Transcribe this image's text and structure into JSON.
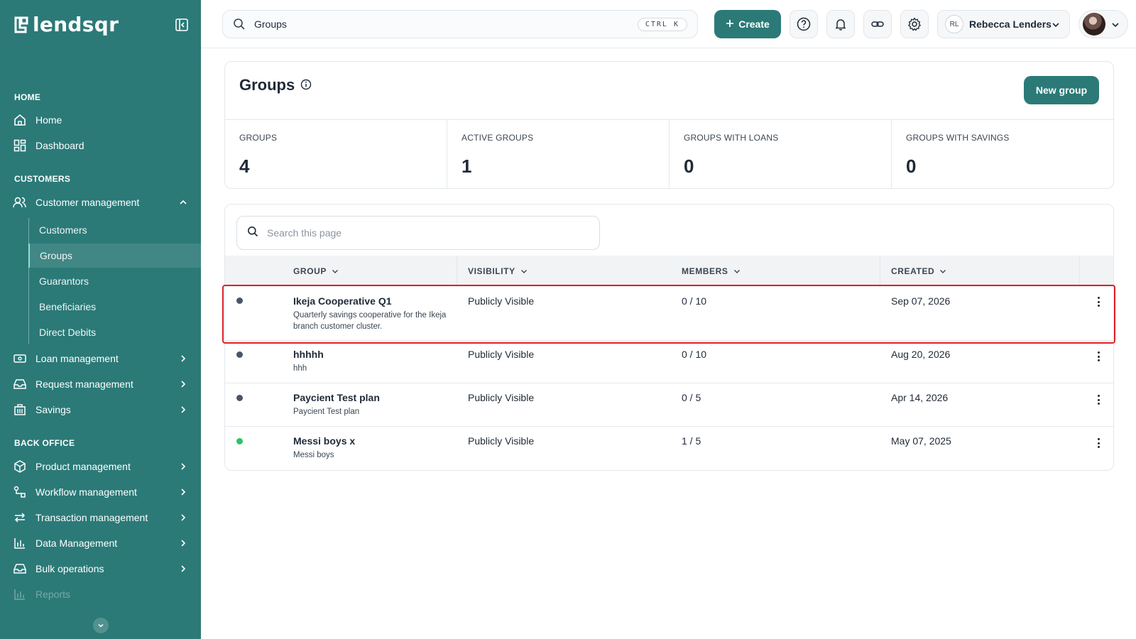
{
  "app": {
    "brand": "lendsqr"
  },
  "sidebar": {
    "sections": {
      "home": "HOME",
      "customers": "CUSTOMERS",
      "back_office": "BACK OFFICE"
    },
    "home_items": [
      {
        "label": "Home",
        "icon": "house-icon"
      },
      {
        "label": "Dashboard",
        "icon": "dashboard-grid-icon"
      }
    ],
    "customer_management": {
      "label": "Customer management",
      "icon": "users-icon"
    },
    "customer_sub_items": [
      {
        "label": "Customers"
      },
      {
        "label": "Groups",
        "active": true
      },
      {
        "label": "Guarantors"
      },
      {
        "label": "Beneficiaries"
      },
      {
        "label": "Direct Debits"
      }
    ],
    "customer_items": [
      {
        "label": "Loan management",
        "icon": "money-icon"
      },
      {
        "label": "Request management",
        "icon": "inbox-icon"
      },
      {
        "label": "Savings",
        "icon": "bank-icon"
      }
    ],
    "back_office_items": [
      {
        "label": "Product management",
        "icon": "box-icon"
      },
      {
        "label": "Workflow management",
        "icon": "workflow-icon"
      },
      {
        "label": "Transaction management",
        "icon": "transfer-arrows-icon"
      },
      {
        "label": "Data Management",
        "icon": "chart-bars-icon"
      },
      {
        "label": "Bulk operations",
        "icon": "inbox-icon"
      },
      {
        "label": "Reports",
        "icon": "chart-bars-icon"
      }
    ]
  },
  "topbar": {
    "search_value": "Groups",
    "shortcut": "CTRL K",
    "create_label": "Create",
    "user_initials": "RL",
    "user_name": "Rebecca Lenders"
  },
  "page": {
    "title": "Groups",
    "new_group_label": "New group",
    "stats": [
      {
        "label": "GROUPS",
        "value": "4"
      },
      {
        "label": "ACTIVE GROUPS",
        "value": "1"
      },
      {
        "label": "GROUPS WITH LOANS",
        "value": "0"
      },
      {
        "label": "GROUPS WITH SAVINGS",
        "value": "0"
      }
    ]
  },
  "table": {
    "search_placeholder": "Search this page",
    "columns": [
      "GROUP",
      "VISIBILITY",
      "MEMBERS",
      "CREATED"
    ],
    "rows": [
      {
        "name": "Ikeja Cooperative Q1",
        "description": "Quarterly savings cooperative for the Ikeja branch customer cluster.",
        "visibility": "Publicly Visible",
        "members": "0 / 10",
        "created": "Sep 07, 2026",
        "status_color": "#4a5566"
      },
      {
        "name": "hhhhh",
        "description": "hhh",
        "visibility": "Publicly Visible",
        "members": "0 / 10",
        "created": "Aug 20, 2026",
        "status_color": "#4a5566"
      },
      {
        "name": "Paycient Test plan",
        "description": "Paycient Test plan",
        "visibility": "Publicly Visible",
        "members": "0 / 5",
        "created": "Apr 14, 2026",
        "status_color": "#4a5566"
      },
      {
        "name": "Messi boys x",
        "description": "Messi boys",
        "visibility": "Publicly Visible",
        "members": "1 / 5",
        "created": "May 07, 2025",
        "status_color": "#2cc464"
      }
    ]
  },
  "colors": {
    "brand": "#2b7a78",
    "highlight": "#e0202a"
  }
}
